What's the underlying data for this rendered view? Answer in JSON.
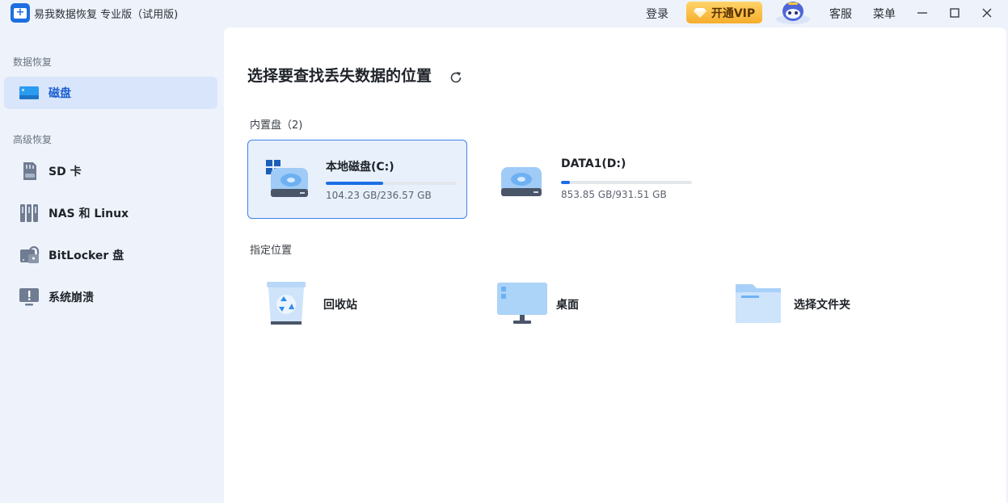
{
  "app": {
    "title": "易我数据恢复 专业版（试用版)"
  },
  "topbar": {
    "login": "登录",
    "vip": "开通VIP",
    "service": "客服",
    "menu": "菜单"
  },
  "sidebar": {
    "section_recovery": "数据恢复",
    "section_advanced": "高级恢复",
    "items": [
      {
        "label": "磁盘",
        "icon": "disk-icon",
        "active": true
      },
      {
        "label": "SD 卡",
        "icon": "sd-card-icon",
        "active": false
      },
      {
        "label": "NAS 和 Linux",
        "icon": "nas-icon",
        "active": false
      },
      {
        "label": "BitLocker 盘",
        "icon": "bitlocker-icon",
        "active": false
      },
      {
        "label": "系统崩溃",
        "icon": "system-crash-icon",
        "active": false
      }
    ]
  },
  "main": {
    "title": "选择要查找丢失数据的位置",
    "internal_section": "内置盘（2)",
    "disks": [
      {
        "name": "本地磁盘(C:)",
        "size": "104.23 GB/236.57 GB",
        "used_fraction": 0.44,
        "selected": true,
        "system": true
      },
      {
        "name": "DATA1(D:)",
        "size": "853.85 GB/931.51 GB",
        "used_fraction": 0.07,
        "selected": false,
        "system": false
      }
    ],
    "locations_section": "指定位置",
    "locations": [
      {
        "label": "回收站",
        "icon": "recycle-bin-icon"
      },
      {
        "label": "桌面",
        "icon": "desktop-icon"
      },
      {
        "label": "选择文件夹",
        "icon": "folder-icon"
      }
    ]
  },
  "colors": {
    "accent": "#1b6fe6",
    "vip_gold": "#f6ad2b",
    "sidebar_bg": "#eef3fb",
    "selected_bg": "#e8f0fc"
  }
}
